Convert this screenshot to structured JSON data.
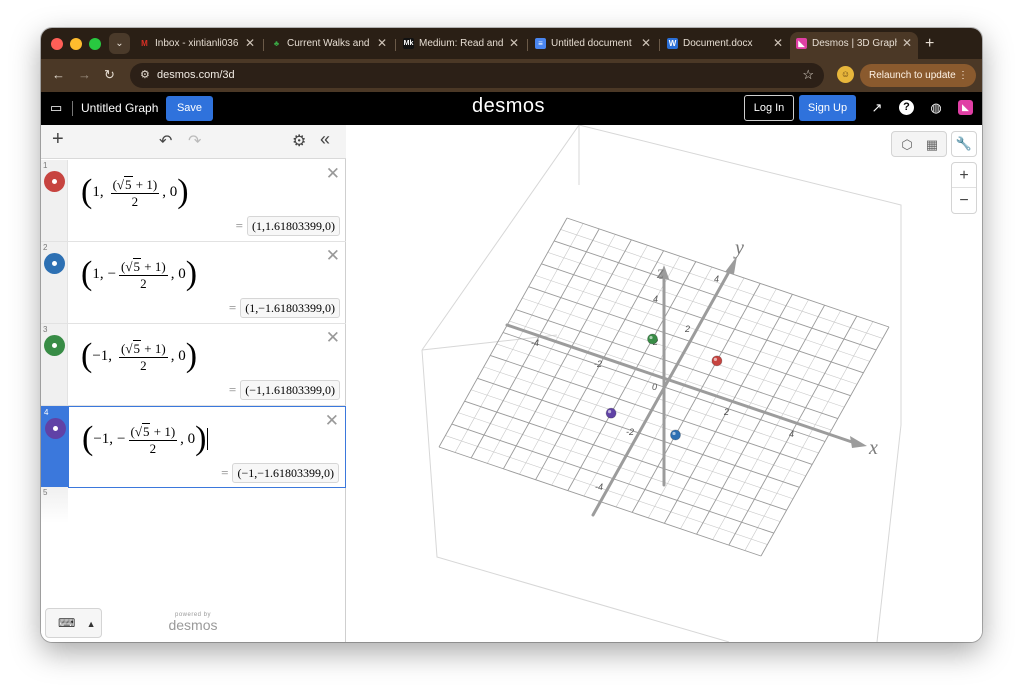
{
  "browser": {
    "tabs": [
      {
        "label": "Inbox - xintianli036",
        "icon": "gmail-icon",
        "color": "#d93025",
        "glyph": "M"
      },
      {
        "label": "Current Walks and",
        "icon": "tree-icon",
        "color": "#3aa845",
        "glyph": "♣"
      },
      {
        "label": "Medium: Read and",
        "icon": "medium-icon",
        "color": "#111111",
        "glyph": "M"
      },
      {
        "label": "Untitled document",
        "icon": "docs-icon",
        "color": "#4a86f0",
        "glyph": "▤"
      },
      {
        "label": "Document.docx",
        "icon": "word-icon",
        "color": "#2b6fd6",
        "glyph": "W"
      },
      {
        "label": "Desmos | 3D Graph",
        "icon": "desmos-icon",
        "color": "#e03fa5",
        "glyph": "◣"
      }
    ],
    "url": "desmos.com/3d",
    "relaunch_label": "Relaunch to update"
  },
  "header": {
    "graph_title": "Untitled Graph",
    "save_label": "Save",
    "logo": "desmos",
    "login_label": "Log In",
    "signup_label": "Sign Up"
  },
  "expressions": [
    {
      "num": "1",
      "color": "#c74440",
      "sign": "",
      "xs": "1,",
      "neg": "",
      "sqrt": "5",
      "tail": "+ 1)",
      "denom": "2",
      "zero": ", 0",
      "result": "(1,1.61803399,0)"
    },
    {
      "num": "2",
      "color": "#2d70b3",
      "sign": "",
      "xs": "1,",
      "neg": "−",
      "sqrt": "5",
      "tail": "+ 1)",
      "denom": "2",
      "zero": ", 0",
      "result": "(1,−1.61803399,0)"
    },
    {
      "num": "3",
      "color": "#388c46",
      "sign": "",
      "xs": "−1,",
      "neg": "",
      "sqrt": "5",
      "tail": "+ 1)",
      "denom": "2",
      "zero": ", 0",
      "result": "(−1,1.61803399,0)"
    },
    {
      "num": "4",
      "color": "#6042a6",
      "sign": "",
      "xs": "−1,",
      "neg": "−",
      "sqrt": "5",
      "tail": "+ 1)",
      "denom": "2",
      "zero": ", 0",
      "result": "(−1,−1.61803399,0)"
    }
  ],
  "empty_row_num": "5",
  "powered_by": {
    "small": "powered by",
    "big": "desmos"
  },
  "axes": {
    "x_label": "x",
    "y_label": "y",
    "z_label": "z",
    "ticks": {
      "x_neg4": "-4",
      "x_neg2": "-2",
      "x_2": "2",
      "x_4": "4",
      "y_neg4": "-4",
      "y_neg2": "-2",
      "y_2": "2",
      "y_4": "4",
      "z_2": "2",
      "z_4": "4",
      "origin": "0"
    }
  },
  "points_3d": [
    {
      "color": "#c74440",
      "x": 1,
      "y": 1.61803399,
      "z": 0
    },
    {
      "color": "#2d70b3",
      "x": 1,
      "y": -1.61803399,
      "z": 0
    },
    {
      "color": "#388c46",
      "x": -1,
      "y": 1.61803399,
      "z": 0
    },
    {
      "color": "#6042a6",
      "x": -1,
      "y": -1.61803399,
      "z": 0
    }
  ]
}
